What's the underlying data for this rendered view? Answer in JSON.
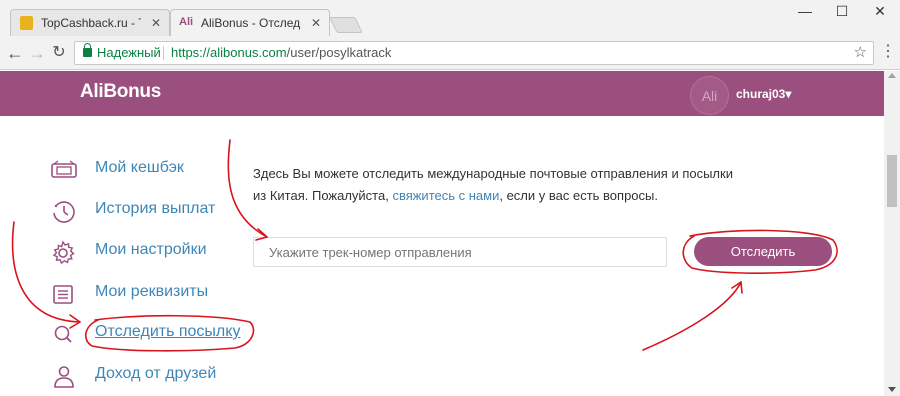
{
  "browser": {
    "tabs": [
      {
        "label": "TopCashback.ru - Топ лу",
        "state": "inactive",
        "favicon_color": "#e8b21d"
      },
      {
        "label": "AliBonus - Отследить по",
        "state": "active",
        "favicon_text": "Ali",
        "favicon_color": "#9a4f7e"
      }
    ],
    "window_controls": {
      "minimize": "—",
      "maximize": "☐",
      "close": "✕"
    },
    "security_label": "Надежный",
    "url_host": "https://alibonus.com",
    "url_path": "/user/posylkatrack"
  },
  "header": {
    "logo": "AliBonus",
    "avatar_initials": "Ali",
    "username": "churaj03▾",
    "brand_color": "#9a4f7e"
  },
  "sidebar": {
    "items": [
      {
        "label": "Мой кешбэк",
        "icon": "wallet-icon"
      },
      {
        "label": "История выплат",
        "icon": "history-icon"
      },
      {
        "label": "Мои настройки",
        "icon": "gear-icon"
      },
      {
        "label": "Мои реквизиты",
        "icon": "document-icon"
      },
      {
        "label": "Отследить посылку",
        "icon": "search-icon"
      },
      {
        "label": "Доход от друзей",
        "icon": "person-icon"
      }
    ]
  },
  "main": {
    "intro_line1": "Здесь Вы можете отследить международные почтовые отправления и посылки",
    "intro_line2_prefix": "из Китая. Пожалуйста, ",
    "intro_link": "свяжитесь с нами",
    "intro_line2_suffix": ", если у вас есть вопросы.",
    "track_placeholder": "Укажите трек-номер отправления",
    "track_value": "",
    "track_button": "Отследить"
  }
}
